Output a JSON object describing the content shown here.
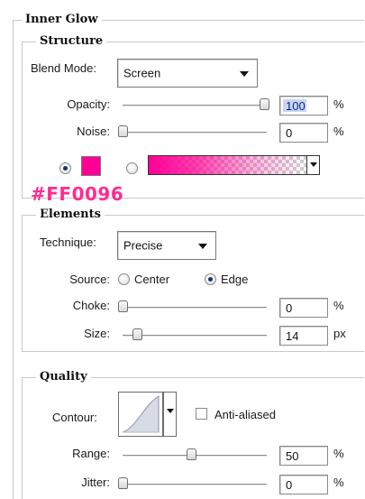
{
  "panel": {
    "title": "Inner Glow"
  },
  "structure": {
    "legend": "Structure",
    "blend_mode": {
      "label": "Blend Mode:",
      "value": "Screen"
    },
    "opacity": {
      "label": "Opacity:",
      "value": "100",
      "unit": "%",
      "slider_fraction": 1.0
    },
    "noise": {
      "label": "Noise:",
      "value": "0",
      "unit": "%",
      "slider_fraction": 0.0
    },
    "color_mode": "solid",
    "glow_color": "#FF0096",
    "glow_color_caption": "#FF0096"
  },
  "elements": {
    "legend": "Elements",
    "technique": {
      "label": "Technique:",
      "value": "Precise"
    },
    "source": {
      "label": "Source:",
      "options": [
        "Center",
        "Edge"
      ],
      "selected": "Edge"
    },
    "choke": {
      "label": "Choke:",
      "value": "0",
      "unit": "%",
      "slider_fraction": 0.0
    },
    "size": {
      "label": "Size:",
      "value": "14",
      "unit": "px",
      "slider_fraction": 0.07
    }
  },
  "quality": {
    "legend": "Quality",
    "contour": {
      "label": "Contour:"
    },
    "anti_aliased": {
      "label": "Anti-aliased",
      "checked": false
    },
    "range": {
      "label": "Range:",
      "value": "50",
      "unit": "%",
      "slider_fraction": 0.5
    },
    "jitter": {
      "label": "Jitter:",
      "value": "0",
      "unit": "%",
      "slider_fraction": 0.0
    }
  },
  "colors": {
    "accent_pink": "#FF0096",
    "caption_pink": "#FF2C92",
    "border": "#C9C9C9"
  }
}
